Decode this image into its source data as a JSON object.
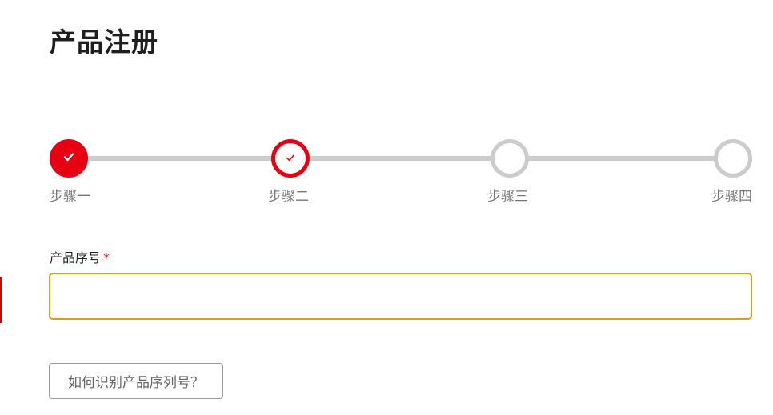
{
  "page": {
    "title": "产品注册"
  },
  "colors": {
    "accent": "#e60012",
    "inactive": "#cccccc",
    "input_focus_border": "#e39b1b"
  },
  "stepper": {
    "steps": [
      {
        "label": "步骤一",
        "state": "completed",
        "icon": "check-icon"
      },
      {
        "label": "步骤二",
        "state": "active",
        "icon": "check-icon"
      },
      {
        "label": "步骤三",
        "state": "pending",
        "icon": ""
      },
      {
        "label": "步骤四",
        "state": "pending",
        "icon": ""
      }
    ]
  },
  "form": {
    "serial_label": "产品序号",
    "required_mark": "*",
    "serial_value": "",
    "serial_placeholder": ""
  },
  "help": {
    "button_label": "如何识别产品序列号？"
  }
}
